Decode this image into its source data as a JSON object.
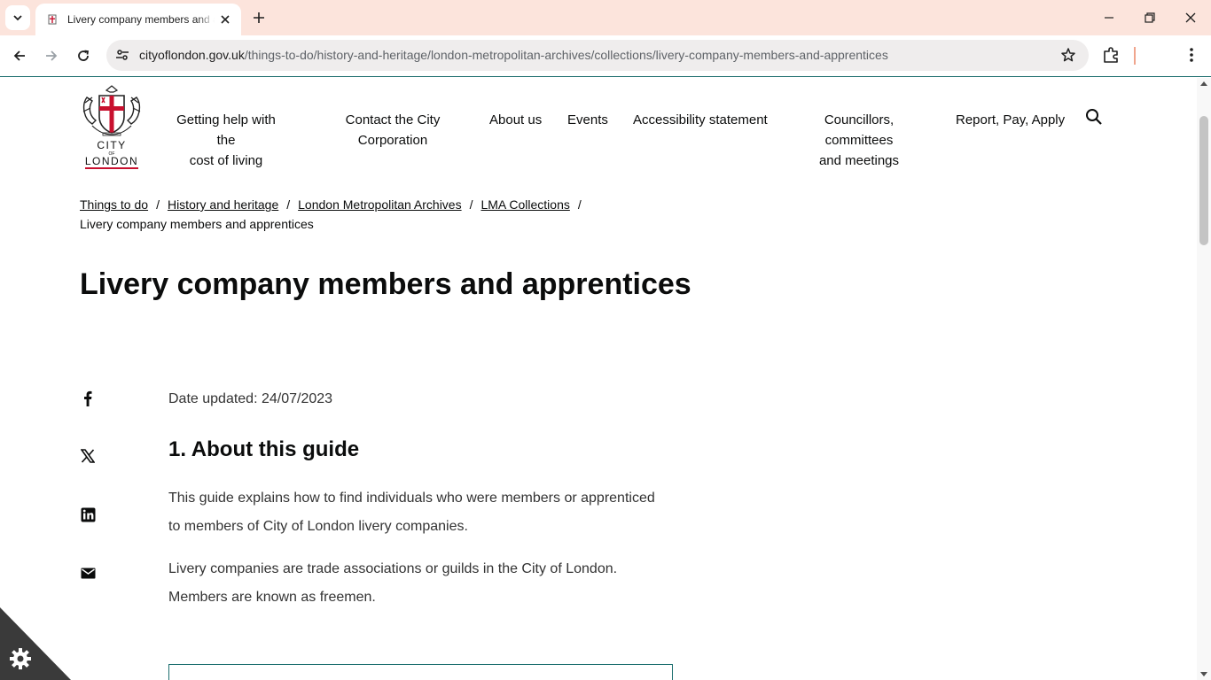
{
  "browser": {
    "tab_title": "Livery company members and apprentices",
    "url_host": "cityoflondon.gov.uk",
    "url_path": "/things-to-do/history-and-heritage/london-metropolitan-archives/collections/livery-company-members-and-apprentices",
    "tab_bar_color": "#fce4dc"
  },
  "site": {
    "logo_line1": "CITY",
    "logo_line2": "OF",
    "logo_line3": "LONDON",
    "nav": [
      {
        "line1": "Getting help with the",
        "line2": "cost of living"
      },
      {
        "line1": "Contact the City",
        "line2": "Corporation"
      },
      {
        "line1": "About us"
      },
      {
        "line1": "Events"
      },
      {
        "line1": "Accessibility statement"
      },
      {
        "line1": "Councillors, committees",
        "line2": "and meetings"
      },
      {
        "line1": "Report, Pay, Apply"
      }
    ]
  },
  "breadcrumb": {
    "items": [
      "Things to do",
      "History and heritage",
      "London Metropolitan Archives",
      "LMA Collections"
    ],
    "separator": "/",
    "current": "Livery company members and apprentices"
  },
  "page": {
    "title": "Livery company members and apprentices",
    "date_updated": "Date updated: 24/07/2023",
    "section_heading": "1. About this guide",
    "paragraph1_line1": "This guide explains how to find individuals who were members or apprenticed",
    "paragraph1_line2": "to members of City of London livery companies.",
    "paragraph2_line1": "Livery companies are trade associations or guilds in the City of London.",
    "paragraph2_line2": "Members are known as freemen."
  },
  "share_icons": [
    "facebook-icon",
    "x-twitter-icon",
    "linkedin-icon",
    "email-icon"
  ],
  "colors": {
    "accent_teal": "#1d6f6f",
    "logo_red": "#c8102e"
  }
}
